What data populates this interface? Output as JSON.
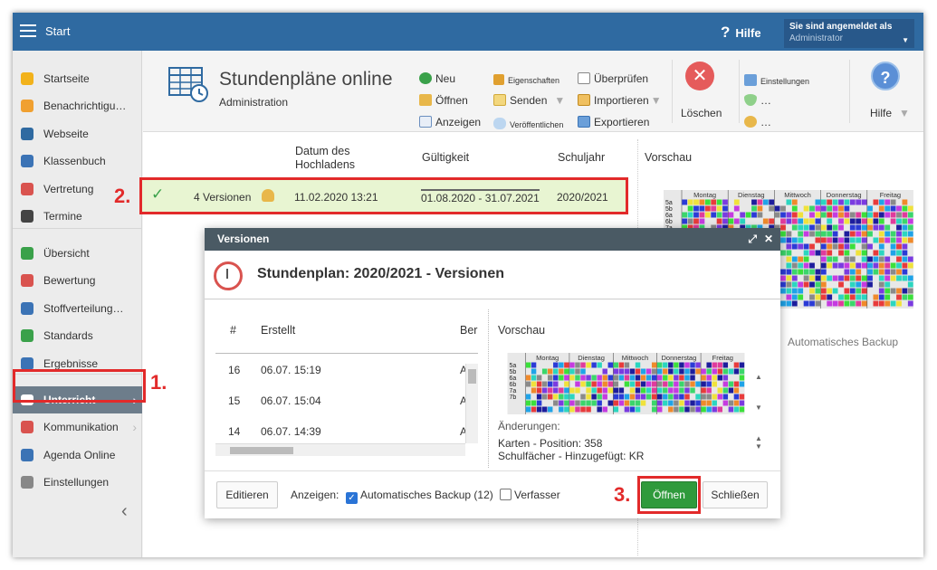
{
  "topbar": {
    "app_title": "Start",
    "help_label": "Hilfe",
    "help_glyph": "?",
    "login_line1": "Sie sind angemeldet als",
    "login_line2": "Administrator"
  },
  "sidebar": {
    "items": [
      {
        "label": "Startseite",
        "icon": "star-icon",
        "color": "#f2b21b"
      },
      {
        "label": "Benachrichtigu…",
        "icon": "mail-icon",
        "color": "#f0a030"
      },
      {
        "label": "Webseite",
        "icon": "globe-icon",
        "color": "#2f6aa1"
      },
      {
        "label": "Klassenbuch",
        "icon": "book-icon",
        "color": "#3b73b5"
      },
      {
        "label": "Vertretung",
        "icon": "person-swap-icon",
        "color": "#d9534f"
      },
      {
        "label": "Termine",
        "icon": "calendar-icon",
        "color": "#444"
      },
      {
        "label": "Übersicht",
        "icon": "check-circle-icon",
        "color": "#3aa14a"
      },
      {
        "label": "Bewertung",
        "icon": "rating-icon",
        "color": "#d9534f"
      },
      {
        "label": "Stoffverteilung…",
        "icon": "briefcase-icon",
        "color": "#3b73b5"
      },
      {
        "label": "Standards",
        "icon": "shield-check-icon",
        "color": "#3aa14a"
      },
      {
        "label": "Ergebnisse",
        "icon": "bar-chart-icon",
        "color": "#3b73b5"
      },
      {
        "label": "Unterricht",
        "icon": "open-book-icon",
        "color": "#fff"
      },
      {
        "label": "Kommunikation",
        "icon": "chat-icon",
        "color": "#d9534f"
      },
      {
        "label": "Agenda Online",
        "icon": "pen-icon",
        "color": "#3b73b5"
      },
      {
        "label": "Einstellungen",
        "icon": "gear-icon",
        "color": "#888"
      }
    ]
  },
  "ribbon": {
    "title": "Stundenpläne online",
    "subtitle": "Administration",
    "neu": "Neu",
    "oeffnen": "Öffnen",
    "anzeigen": "Anzeigen",
    "eigenschaften": "Eigenschaften",
    "senden": "Senden",
    "veroeffentlichen": "Veröffentlichen",
    "ueberpruefen": "Überprüfen",
    "importieren": "Importieren",
    "exportieren": "Exportieren",
    "loeschen": "Löschen",
    "einstellungen": "Einstellungen",
    "dots1": "…",
    "dots2": "…",
    "hilfe": "Hilfe"
  },
  "table": {
    "headers": {
      "datum": "Datum des Hochladens",
      "gueltigkeit": "Gültigkeit",
      "schuljahr": "Schuljahr",
      "vorschau": "Vorschau"
    },
    "row": {
      "versions": "4 Versionen",
      "datum": "11.02.2020 13:21",
      "gueltigkeit": "01.08.2020 - 31.07.2021",
      "schuljahr": "2020/2021"
    },
    "auto_backup": "Automatisches Backup"
  },
  "preview": {
    "days": [
      "Montag",
      "Dienstag",
      "Mittwoch",
      "Donnerstag",
      "Freitag"
    ],
    "classes": [
      "5a",
      "5b",
      "6a",
      "6b",
      "7a",
      "7b"
    ]
  },
  "steps": {
    "s1": "1.",
    "s2": "2.",
    "s3": "3."
  },
  "dialog": {
    "header": "Versionen",
    "title": "Stundenplan: 2020/2021 - Versionen",
    "col_num": "#",
    "col_erstellt": "Erstellt",
    "col_ber": "Ber",
    "col_vorschau": "Vorschau",
    "rows": [
      {
        "num": "16",
        "erstellt": "06.07. 15:19",
        "ber": "A"
      },
      {
        "num": "15",
        "erstellt": "06.07. 15:04",
        "ber": "A"
      },
      {
        "num": "14",
        "erstellt": "06.07. 14:39",
        "ber": "A"
      }
    ],
    "aenderungen": "Änderungen:",
    "aend1": "Karten - Position: 358",
    "aend2": "Schulfächer - Hinzugefügt: KR",
    "editieren": "Editieren",
    "anzeigen": "Anzeigen:",
    "auto_backup": "Automatisches Backup (12)",
    "verfasser": "Verfasser",
    "oeffnen": "Öffnen",
    "schliessen": "Schließen"
  }
}
